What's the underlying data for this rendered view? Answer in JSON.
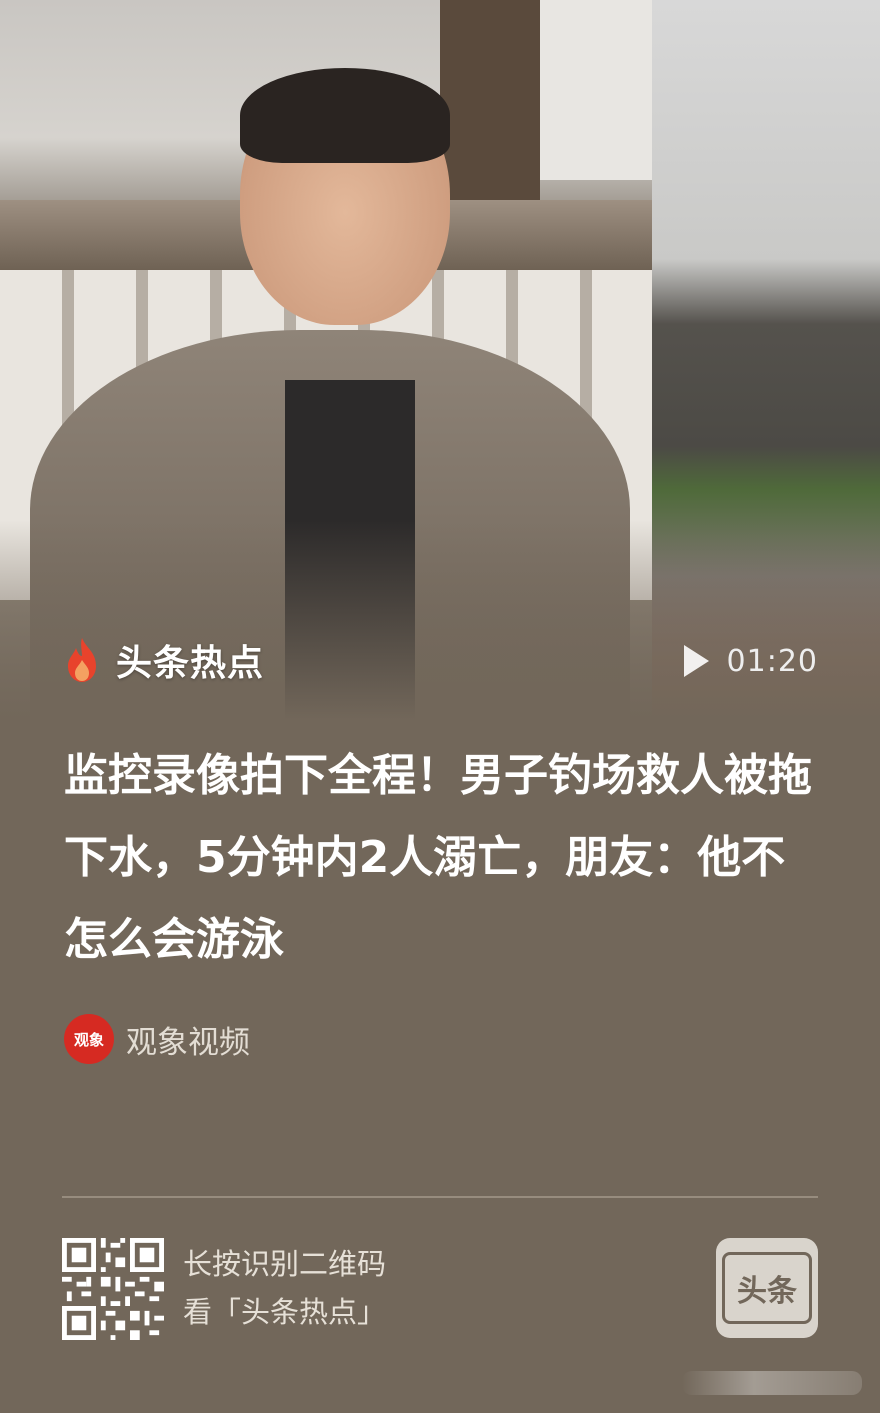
{
  "video": {
    "brand_label": "头条热点",
    "duration": "01:20"
  },
  "article": {
    "headline": "监控录像拍下全程！男子钓场救人被拖下水，5分钟内2人溺亡，朋友：他不怎么会游泳",
    "source_name": "观象视频",
    "source_logo_text": "观象"
  },
  "footer": {
    "qr_line1": "长按识别二维码",
    "qr_line2": "看「头条热点」",
    "app_badge_text": "头条"
  },
  "colors": {
    "background": "#72675a",
    "flame": "#e8432c",
    "source_logo": "#d62a22"
  }
}
